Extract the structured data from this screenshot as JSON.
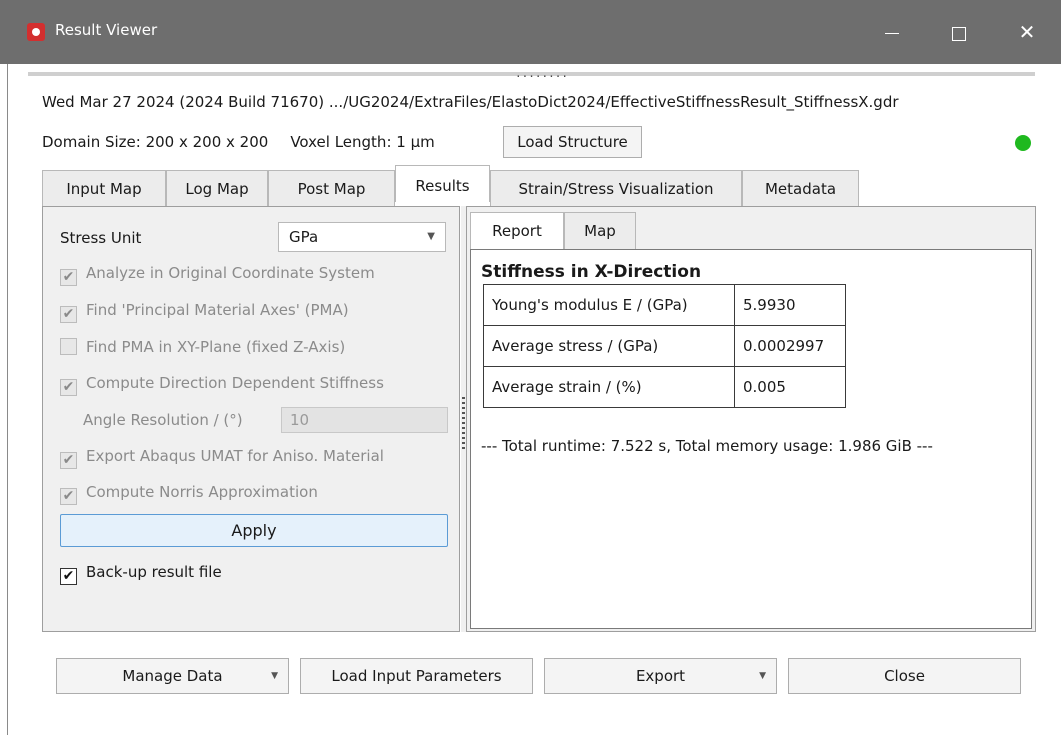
{
  "window": {
    "title": "Result Viewer",
    "controls": {
      "minimize": "—",
      "maximize": "☐",
      "close": "✕"
    }
  },
  "header": {
    "info_line": "Wed Mar 27 2024 (2024 Build 71670)   .../UG2024/ExtraFiles/ElastoDict2024/EffectiveStiffnessResult_StiffnessX.gdr",
    "domain_size": "Domain Size: 200 x 200 x 200",
    "voxel_length": "Voxel Length: 1 µm",
    "load_structure_label": "Load Structure",
    "status_color": "#1fb91f",
    "grip": "........"
  },
  "tabs": [
    {
      "label": "Input Map"
    },
    {
      "label": "Log Map"
    },
    {
      "label": "Post Map"
    },
    {
      "label": "Results",
      "active": true
    },
    {
      "label": "Strain/Stress Visualization"
    },
    {
      "label": "Metadata"
    }
  ],
  "left_panel": {
    "stress_unit_label": "Stress Unit",
    "stress_unit_value": "GPa",
    "options": [
      {
        "label": "Analyze in Original Coordinate System",
        "checked": true,
        "enabled": false
      },
      {
        "label": "Find 'Principal Material Axes' (PMA)",
        "checked": true,
        "enabled": false
      },
      {
        "label": "Find PMA in XY-Plane (fixed Z-Axis)",
        "checked": false,
        "enabled": false
      },
      {
        "label": "Compute Direction Dependent Stiffness",
        "checked": true,
        "enabled": false
      },
      {
        "label": "Export Abaqus UMAT for Aniso. Material",
        "checked": true,
        "enabled": false
      },
      {
        "label": "Compute Norris Approximation",
        "checked": true,
        "enabled": false
      }
    ],
    "angle_resolution_label": "Angle Resolution / (°)",
    "angle_resolution_value": "10",
    "apply_label": "Apply",
    "backup_label": "Back-up result file",
    "backup_checked": true,
    "check_mark": "✔"
  },
  "right_panel": {
    "tabs": [
      {
        "label": "Report",
        "active": true
      },
      {
        "label": "Map"
      }
    ],
    "report_title": "Stiffness in X-Direction",
    "rows": [
      {
        "key": "Young's modulus E / (GPa)",
        "value": "5.9930"
      },
      {
        "key": "Average stress / (GPa)",
        "value": "0.0002997"
      },
      {
        "key": "Average strain / (%)",
        "value": "0.005"
      }
    ],
    "runtime": "--- Total runtime: 7.522 s, Total memory usage: 1.986 GiB ---"
  },
  "bottom_bar": {
    "manage_data": "Manage Data",
    "load_input_parameters": "Load Input Parameters",
    "export": "Export",
    "close": "Close",
    "dropdown_arrow": "▼"
  }
}
